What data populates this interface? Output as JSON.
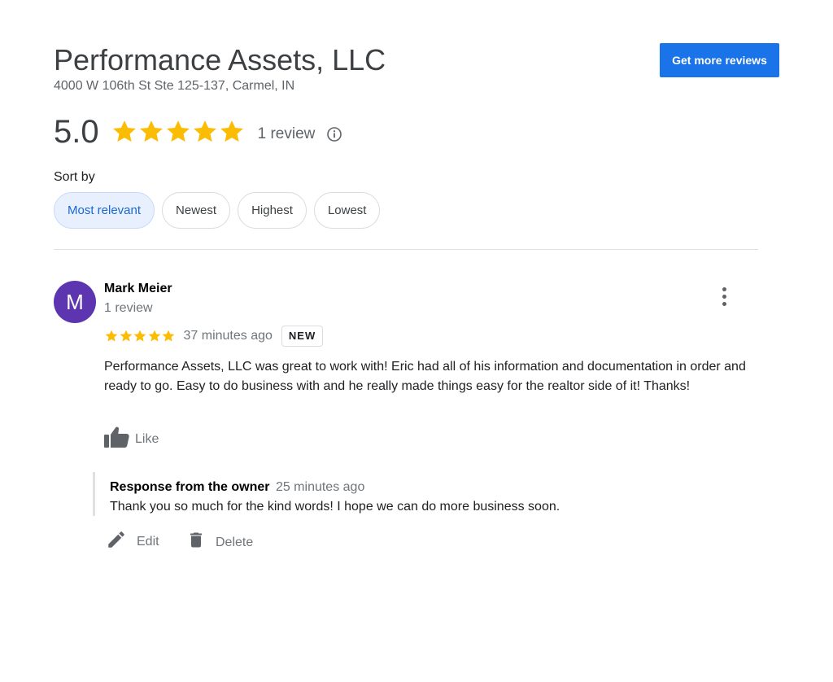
{
  "business": {
    "name": "Performance Assets, LLC",
    "address": "4000 W 106th St Ste 125-137, Carmel, IN",
    "get_more_reviews_label": "Get more reviews",
    "rating": "5.0",
    "rating_value": 5,
    "review_count_label": "1 review"
  },
  "sort": {
    "label": "Sort by",
    "options": [
      "Most relevant",
      "Newest",
      "Highest",
      "Lowest"
    ],
    "selected": "Most relevant"
  },
  "review": {
    "avatar_initial": "M",
    "reviewer_name": "Mark Meier",
    "reviewer_review_count": "1 review",
    "stars": 5,
    "time_ago": "37 minutes ago",
    "badge": "NEW",
    "text": "Performance Assets, LLC was great to work with!  Eric had all of his information and documentation in order and ready to go.  Easy to do business with and he really made things easy for the realtor side of it! Thanks!",
    "like_label": "Like"
  },
  "owner_response": {
    "title": "Response from the owner",
    "time_ago": "25 minutes ago",
    "text": "Thank you so much for the kind words! I hope we can do more business soon.",
    "edit_label": "Edit",
    "delete_label": "Delete"
  },
  "icons": {
    "star": "star-icon",
    "info": "info-icon",
    "more": "more-vert-icon",
    "like": "thumb-up-icon",
    "edit": "pencil-icon",
    "delete": "trash-icon"
  },
  "colors": {
    "star": "#fbbc04",
    "accent": "#1a73e8",
    "chip_active_bg": "#e8f0fe",
    "chip_active_text": "#1967d2",
    "avatar_bg": "#5e35b1"
  }
}
